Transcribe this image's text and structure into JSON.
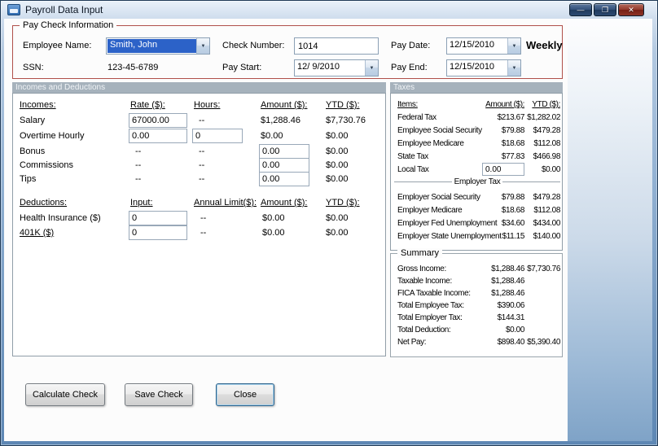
{
  "window": {
    "title": "Payroll Data Input",
    "minimize_glyph": "—",
    "maximize_glyph": "❐",
    "close_glyph": "✕"
  },
  "icons": {
    "dropdown": "▼"
  },
  "paycheck": {
    "label": "Pay Check Information",
    "employee_name": {
      "label": "Employee Name:",
      "value": "Smith, John"
    },
    "ssn": {
      "label": "SSN:",
      "value": "123-45-6789"
    },
    "check_number": {
      "label": "Check Number:",
      "value": "1014"
    },
    "pay_start": {
      "label": "Pay Start:",
      "value": "12/ 9/2010"
    },
    "pay_date": {
      "label": "Pay Date:",
      "value": "12/15/2010"
    },
    "pay_end": {
      "label": "Pay End:",
      "value": "12/15/2010"
    },
    "frequency": "Weekly"
  },
  "sections": {
    "incomes_deductions": "Incomes and Deductions",
    "taxes": "Taxes"
  },
  "incomes": {
    "headers": {
      "name": "Incomes:",
      "rate": "Rate ($):",
      "hours": "Hours:",
      "amount": "Amount ($):",
      "ytd": "YTD ($):"
    },
    "rows": [
      {
        "name": "Salary",
        "rate": "67000.00",
        "hours": "--",
        "amount": "$1,288.46",
        "ytd": "$7,730.76"
      },
      {
        "name": "Overtime Hourly",
        "rate": "0.00",
        "hours": "0",
        "amount": "$0.00",
        "ytd": "$0.00"
      },
      {
        "name": "Bonus",
        "rate": "--",
        "hours": "--",
        "amount": "0.00",
        "ytd": "$0.00"
      },
      {
        "name": "Commissions",
        "rate": "--",
        "hours": "--",
        "amount": "0.00",
        "ytd": "$0.00"
      },
      {
        "name": "Tips",
        "rate": "--",
        "hours": "--",
        "amount": "0.00",
        "ytd": "$0.00"
      }
    ]
  },
  "deductions": {
    "headers": {
      "name": "Deductions:",
      "input": "Input:",
      "limit": "Annual Limit($):",
      "amount": "Amount ($):",
      "ytd": "YTD ($):"
    },
    "rows": [
      {
        "name": "Health Insurance ($)",
        "input": "0",
        "limit": "--",
        "amount": "$0.00",
        "ytd": "$0.00"
      },
      {
        "name": "401K ($)",
        "input": "0",
        "limit": "--",
        "amount": "$0.00",
        "ytd": "$0.00"
      }
    ]
  },
  "taxes": {
    "headers": {
      "items": "Items:",
      "amount": "Amount ($):",
      "ytd": "YTD ($):"
    },
    "employee_rows": [
      {
        "name": "Federal Tax",
        "amount": "$213.67",
        "ytd": "$1,282.02"
      },
      {
        "name": "Employee Social Security",
        "amount": "$79.88",
        "ytd": "$479.28"
      },
      {
        "name": "Employee Medicare",
        "amount": "$18.68",
        "ytd": "$112.08"
      },
      {
        "name": "State Tax",
        "amount": "$77.83",
        "ytd": "$466.98"
      },
      {
        "name": "Local Tax",
        "amount": "0.00",
        "ytd": "$0.00"
      }
    ],
    "employer_section_label": "Employer Tax",
    "employer_rows": [
      {
        "name": "Employer Social Security",
        "amount": "$79.88",
        "ytd": "$479.28"
      },
      {
        "name": "Employer Medicare",
        "amount": "$18.68",
        "ytd": "$112.08"
      },
      {
        "name": "Employer Fed Unemployment",
        "amount": "$34.60",
        "ytd": "$434.00"
      },
      {
        "name": "Employer State Unemployment",
        "amount": "$11.15",
        "ytd": "$140.00"
      }
    ]
  },
  "summary": {
    "label": "Summary",
    "rows": [
      {
        "name": "Gross Income:",
        "amount": "$1,288.46",
        "ytd": "$7,730.76"
      },
      {
        "name": "Taxable Income:",
        "amount": "$1,288.46",
        "ytd": ""
      },
      {
        "name": "FICA Taxable Income:",
        "amount": "$1,288.46",
        "ytd": ""
      },
      {
        "name": "Total Employee Tax:",
        "amount": "$390.06",
        "ytd": ""
      },
      {
        "name": "Total Employer Tax:",
        "amount": "$144.31",
        "ytd": ""
      },
      {
        "name": "Total Deduction:",
        "amount": "$0.00",
        "ytd": ""
      },
      {
        "name": "Net Pay:",
        "amount": "$898.40",
        "ytd": "$5,390.40"
      }
    ]
  },
  "actions": {
    "calculate": "Calculate Check",
    "save": "Save Check",
    "close": "Close"
  },
  "colors": {
    "paycheck_border": "#b0504a",
    "section_header_bg": "#a6b2bc",
    "selection_bg": "#2c62c8"
  }
}
